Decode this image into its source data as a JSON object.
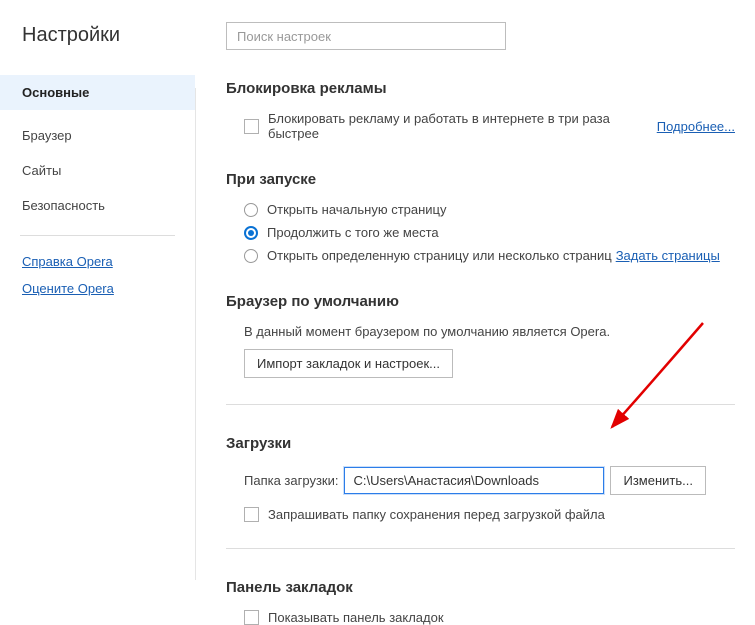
{
  "sidebar": {
    "title": "Настройки",
    "items": [
      {
        "label": "Основные"
      },
      {
        "label": "Браузер"
      },
      {
        "label": "Сайты"
      },
      {
        "label": "Безопасность"
      }
    ],
    "links": [
      {
        "label": "Справка Opera"
      },
      {
        "label": "Оцените Opera"
      }
    ]
  },
  "search": {
    "placeholder": "Поиск настроек"
  },
  "adblock": {
    "title": "Блокировка рекламы",
    "checkbox_label": "Блокировать рекламу и работать в интернете в три раза быстрее",
    "more": "Подробнее..."
  },
  "startup": {
    "title": "При запуске",
    "opt1": "Открыть начальную страницу",
    "opt2": "Продолжить с того же места",
    "opt3": "Открыть определенную страницу или несколько страниц",
    "set_pages": "Задать страницы"
  },
  "default_browser": {
    "title": "Браузер по умолчанию",
    "desc": "В данный момент браузером по умолчанию является Opera.",
    "import_btn": "Импорт закладок и настроек..."
  },
  "downloads": {
    "title": "Загрузки",
    "folder_label": "Папка загрузки:",
    "path": "C:\\Users\\Анастасия\\Downloads",
    "change_btn": "Изменить...",
    "ask_checkbox": "Запрашивать папку сохранения перед загрузкой файла"
  },
  "bookmarks": {
    "title": "Панель закладок",
    "show_checkbox": "Показывать панель закладок"
  }
}
